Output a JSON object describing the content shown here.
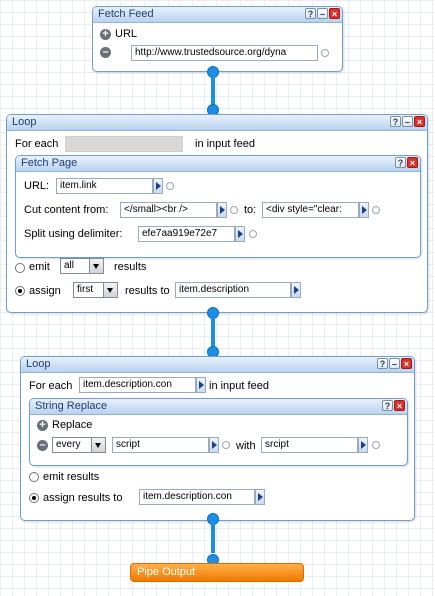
{
  "fetch_feed": {
    "title": "Fetch Feed",
    "url_label": "URL",
    "url_value": "http://www.trustedsource.org/dyna"
  },
  "loop1": {
    "title": "Loop",
    "for_each": "For each",
    "in_input_feed": "in input feed",
    "fetch_page": {
      "title": "Fetch Page",
      "url_label": "URL:",
      "url_value": "item.link",
      "cut_label": "Cut content from:",
      "cut_from": "</small><br />",
      "to_label": "to:",
      "cut_to": "<div style=\"clear:",
      "split_label": "Split using delimiter:",
      "split_value": "efe7aa919e72e7"
    },
    "emit": "emit",
    "emit_select": "all",
    "results": "results",
    "assign": "assign",
    "assign_select": "first",
    "results_to": "results to",
    "assign_target": "item.description"
  },
  "loop2": {
    "title": "Loop",
    "for_each": "For each",
    "item_value": "item.description.con",
    "in_input_feed": "in input feed",
    "string_replace": {
      "title": "String Replace",
      "replace_label": "Replace",
      "mode_select": "every",
      "find_value": "script",
      "with_label": "with",
      "replace_value": "srcipt"
    },
    "emit_results": "emit results",
    "assign_results_to": "assign results to",
    "assign_target": "item.description.con"
  },
  "pipe_output": {
    "title": "Pipe Output"
  }
}
